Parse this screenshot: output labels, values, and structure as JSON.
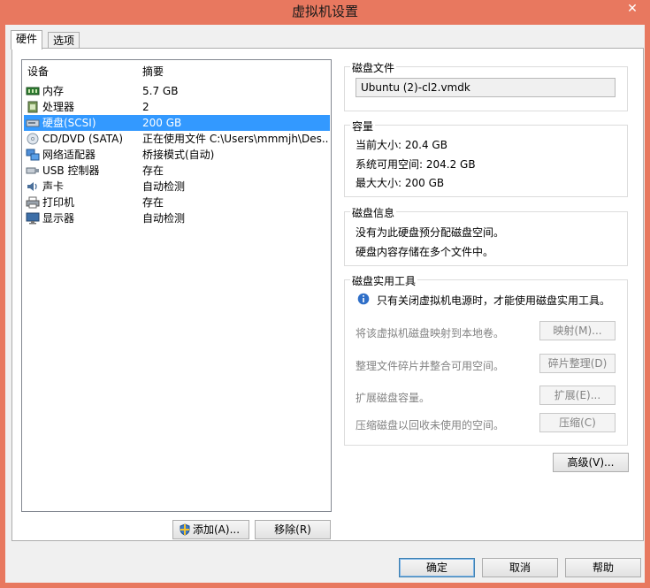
{
  "window": {
    "title": "虚拟机设置",
    "close_glyph": "✕"
  },
  "tabs": [
    {
      "label": "硬件"
    },
    {
      "label": "选项"
    }
  ],
  "device_list": {
    "col_device": "设备",
    "col_summary": "摘要",
    "rows": [
      {
        "name": "内存",
        "summary": "5.7 GB",
        "icon": "memory-icon"
      },
      {
        "name": "处理器",
        "summary": "2",
        "icon": "processor-icon"
      },
      {
        "name": "硬盘(SCSI)",
        "summary": "200 GB",
        "icon": "hard-disk-icon",
        "selected": true
      },
      {
        "name": "CD/DVD (SATA)",
        "summary": "正在使用文件 C:\\Users\\mmmjh\\Des...",
        "icon": "cd-dvd-icon"
      },
      {
        "name": "网络适配器",
        "summary": "桥接模式(自动)",
        "icon": "network-adapter-icon"
      },
      {
        "name": "USB 控制器",
        "summary": "存在",
        "icon": "usb-icon"
      },
      {
        "name": "声卡",
        "summary": "自动检测",
        "icon": "sound-card-icon"
      },
      {
        "name": "打印机",
        "summary": "存在",
        "icon": "printer-icon"
      },
      {
        "name": "显示器",
        "summary": "自动检测",
        "icon": "display-icon"
      }
    ]
  },
  "list_buttons": {
    "add": "添加(A)...",
    "remove": "移除(R)"
  },
  "disk_file": {
    "legend": "磁盘文件",
    "value": "Ubuntu (2)-cl2.vmdk"
  },
  "capacity": {
    "legend": "容量",
    "current": "当前大小: 20.4 GB",
    "available": "系统可用空间: 204.2 GB",
    "max": "最大大小: 200 GB"
  },
  "disk_info": {
    "legend": "磁盘信息",
    "line1": "没有为此硬盘预分配磁盘空间。",
    "line2": "硬盘内容存储在多个文件中。"
  },
  "disk_utilities": {
    "legend": "磁盘实用工具",
    "notice": "只有关闭虚拟机电源时，才能使用磁盘实用工具。",
    "actions": [
      {
        "desc": "将该虚拟机磁盘映射到本地卷。",
        "button": "映射(M)..."
      },
      {
        "desc": "整理文件碎片并整合可用空间。",
        "button": "碎片整理(D)"
      },
      {
        "desc": "扩展磁盘容量。",
        "button": "扩展(E)..."
      },
      {
        "desc": "压缩磁盘以回收未使用的空间。",
        "button": "压缩(C)"
      }
    ]
  },
  "advanced_button": "高级(V)...",
  "footer": {
    "ok": "确定",
    "cancel": "取消",
    "help": "帮助"
  },
  "colors": {
    "titlebar": "#e8785f",
    "selection": "#3399ff",
    "disabled_text": "#838383"
  }
}
